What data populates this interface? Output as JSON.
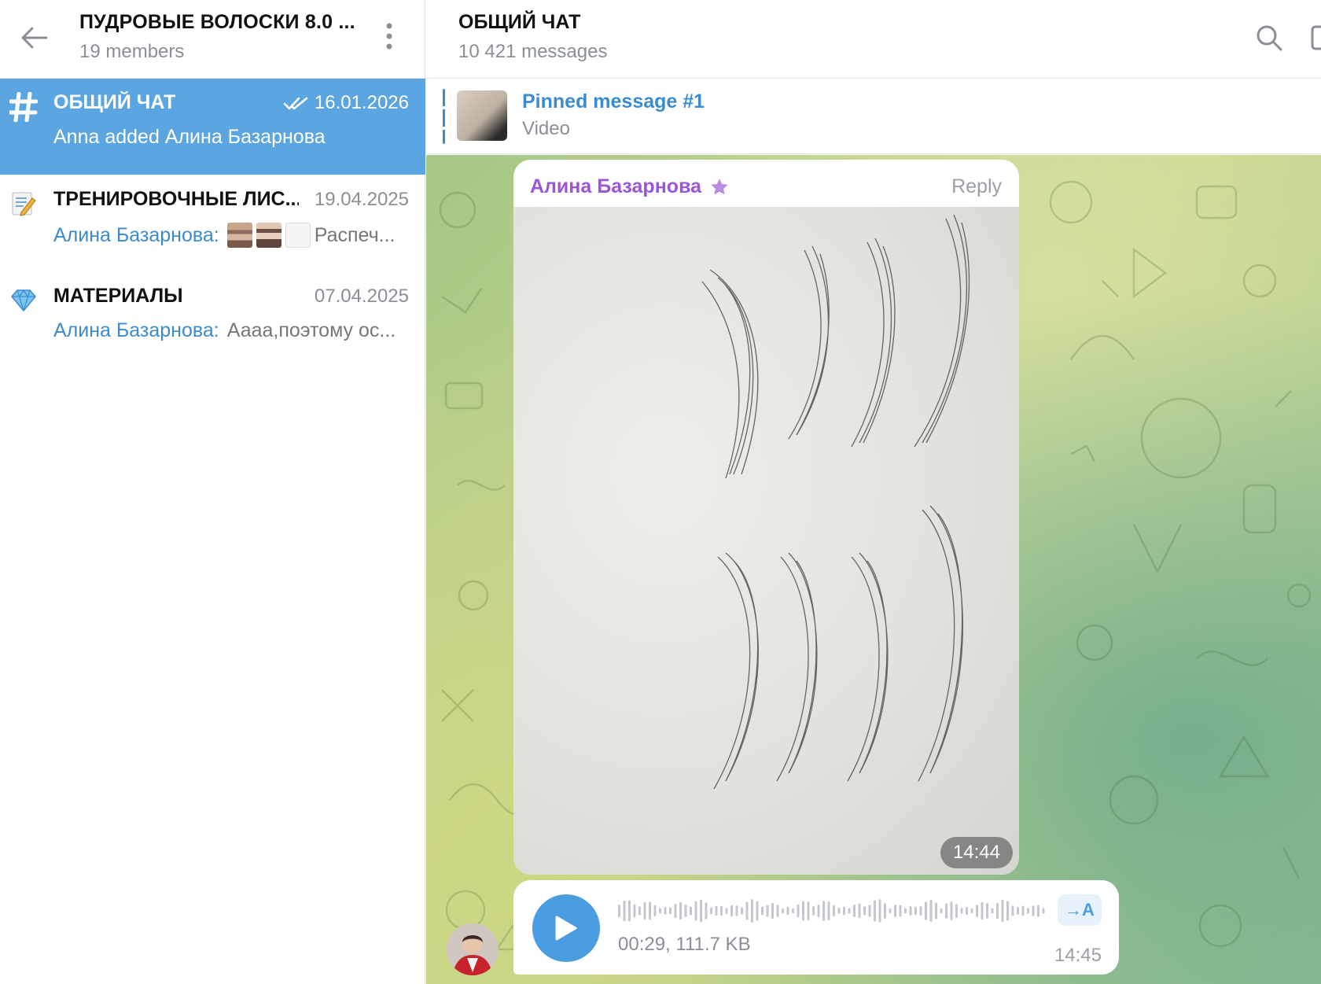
{
  "sidebar": {
    "group_title": "ПУДРОВЫЕ ВОЛОСКИ 8.0 ...",
    "members": "19 members",
    "topics": [
      {
        "title": "ОБЩИЙ ЧАТ",
        "date": "16.01.2026",
        "preview": "Anna added Алина Базарнова",
        "icon": "hash-icon",
        "active": true
      },
      {
        "title": "ТРЕНИРОВОЧНЫЕ ЛИС...",
        "date": "19.04.2025",
        "sender": "Алина Базарнова:",
        "preview": "Распеч...",
        "icon": "memo-icon"
      },
      {
        "title": "МАТЕРИАЛЫ",
        "date": "07.04.2025",
        "sender": "Алина Базарнова:",
        "preview": "Аааа,поэтому ос...",
        "icon": "gem-icon"
      }
    ]
  },
  "chat": {
    "title": "ОБЩИЙ ЧАТ",
    "messages_count": "10 421 messages",
    "pinned": {
      "title": "Pinned message #1",
      "subtitle": "Video"
    },
    "photo_message": {
      "sender": "Алина Базарнова",
      "reply_label": "Reply",
      "time": "14:44"
    },
    "voice_message": {
      "meta": "00:29, 111.7 KB",
      "transcribe_label": "→A",
      "time": "14:45"
    }
  },
  "colors": {
    "accent": "#5ba5e0",
    "link": "#3a8bd0",
    "sender_name": "#9a55d9",
    "play_button": "#4a9de0"
  }
}
